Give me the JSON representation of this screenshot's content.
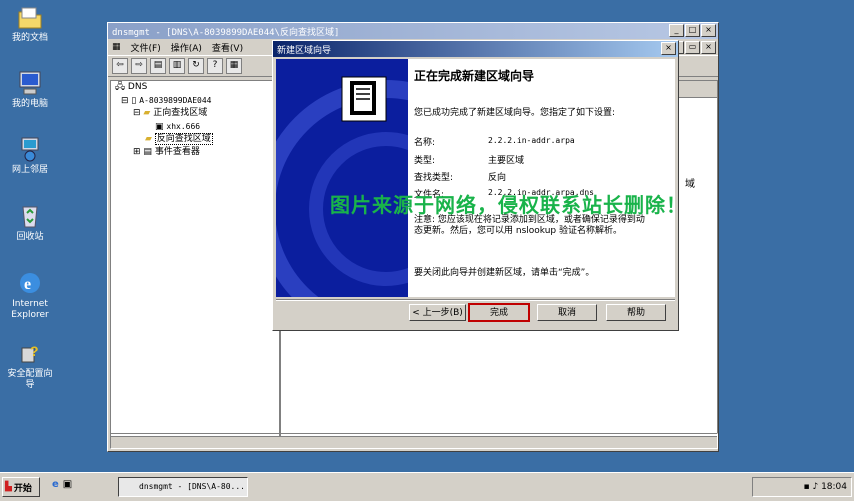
{
  "desktop": {
    "icons": [
      {
        "label": "我的文档",
        "icon": "folder-icon"
      },
      {
        "label": "我的电脑",
        "icon": "computer-icon"
      },
      {
        "label": "网上邻居",
        "icon": "network-icon"
      },
      {
        "label": "回收站",
        "icon": "recycle-bin-icon"
      },
      {
        "label": "Internet Explorer",
        "icon": "ie-icon"
      },
      {
        "label": "安全配置向导",
        "icon": "security-wizard-icon"
      }
    ]
  },
  "mmc": {
    "title": "dnsmgmt - [DNS\\A-8039899DAE044\\反向查找区域]",
    "menu": [
      "文件(F)",
      "操作(A)",
      "查看(V)"
    ],
    "tree": {
      "root": "DNS",
      "server": "A-8039899DAE044",
      "forward_zone": "正向查找区域",
      "forward_child": "xhx.666",
      "reverse_zone": "反向查找区域",
      "event_viewer": "事件查看器"
    },
    "right_text": "域"
  },
  "wizard": {
    "title": "新建区域向导",
    "heading": "正在完成新建区域向导",
    "intro": "您已成功完成了新建区域向导。您指定了如下设置:",
    "fields": [
      {
        "label": "名称:",
        "value": "2.2.2.in-addr.arpa"
      },
      {
        "label": "类型:",
        "value": "主要区域"
      },
      {
        "label": "查找类型:",
        "value": "反向"
      },
      {
        "label": "文件名:",
        "value": "2.2.2.in-addr.arpa.dns"
      }
    ],
    "note": "注意: 您应该现在将记录添加到区域，或者确保记录得到动态更新。然后，您可以用 nslookup 验证名称解析。",
    "closing": "要关闭此向导并创建新区域，请单击“完成”。",
    "buttons": {
      "back": "< 上一步(B)",
      "finish": "完成",
      "cancel": "取消",
      "help": "帮助"
    }
  },
  "watermark": "图片来源于网络，侵权联系站长删除！",
  "taskbar": {
    "start": "开始",
    "task": "dnsmgmt - [DNS\\A-80...",
    "clock": "18:04"
  },
  "colors": {
    "desktop": "#3a6ea5",
    "finish_highlight": "#c00000",
    "watermark": "#19b34a"
  }
}
